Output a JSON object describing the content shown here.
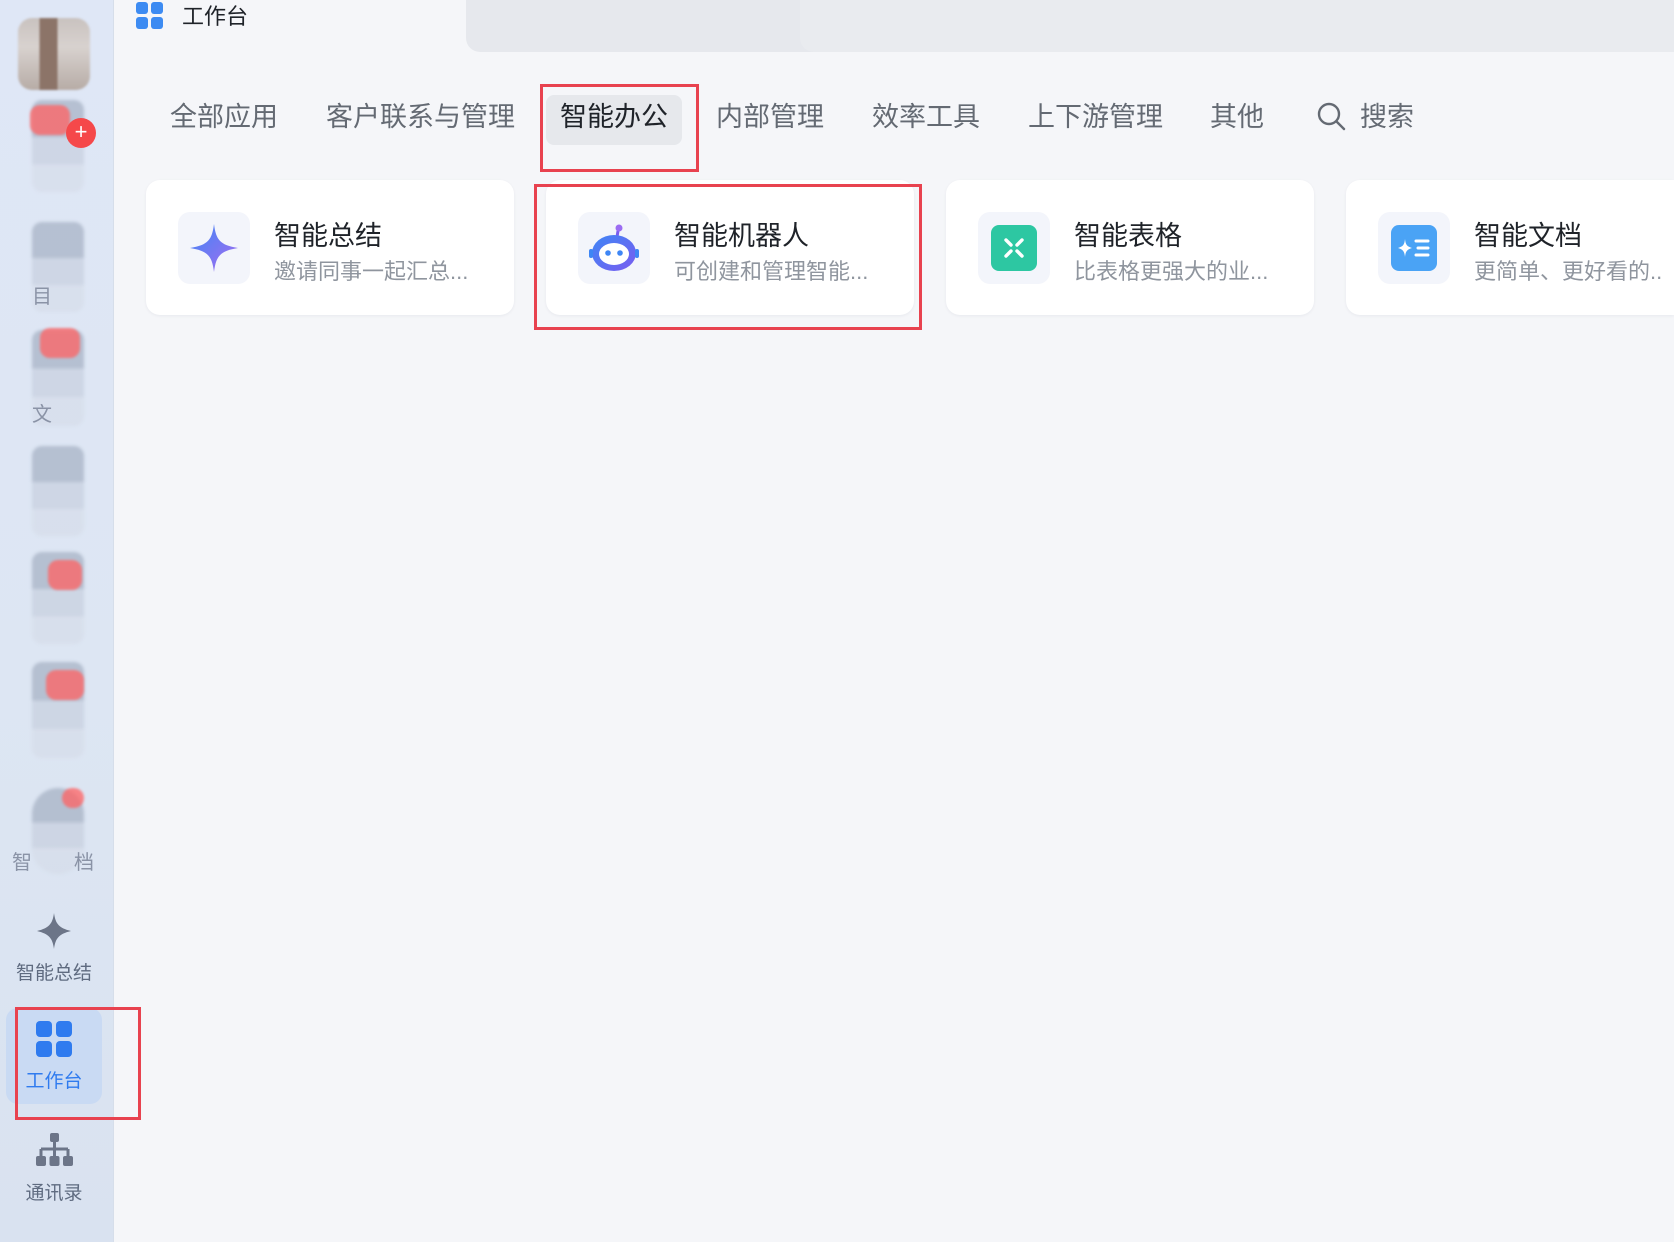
{
  "header": {
    "title": "工作台",
    "icon": "grid-apps-icon"
  },
  "sidebar": {
    "blurred_labels": [
      "目",
      "文",
      "智",
      "档"
    ],
    "badge": "+",
    "items": [
      {
        "label": "智能总结",
        "icon": "sparkle-icon"
      },
      {
        "label": "工作台",
        "icon": "grid-apps-icon",
        "active": true
      },
      {
        "label": "通讯录",
        "icon": "org-chart-icon"
      }
    ]
  },
  "tabs": [
    {
      "label": "全部应用"
    },
    {
      "label": "客户联系与管理"
    },
    {
      "label": "智能办公",
      "active": true
    },
    {
      "label": "内部管理"
    },
    {
      "label": "效率工具"
    },
    {
      "label": "上下游管理"
    },
    {
      "label": "其他"
    }
  ],
  "search": {
    "label": "搜索",
    "icon": "search-icon"
  },
  "apps": [
    {
      "title": "智能总结",
      "desc": "邀请同事一起汇总...",
      "icon": "sparkle-icon",
      "color": "#6f8cf5"
    },
    {
      "title": "智能机器人",
      "desc": "可创建和管理智能...",
      "icon": "robot-icon",
      "color": "#3d8bf2"
    },
    {
      "title": "智能表格",
      "desc": "比表格更强大的业...",
      "icon": "smart-sheet-icon",
      "color": "#2dc7a2"
    },
    {
      "title": "智能文档",
      "desc": "更简单、更好看的...",
      "icon": "smart-doc-icon",
      "color": "#4aa3f5"
    }
  ],
  "colors": {
    "highlight": "#e8424f",
    "active_nav_bg": "#c9daf3",
    "active_nav_text": "#2f7bef",
    "badge_red": "#f5484a"
  }
}
